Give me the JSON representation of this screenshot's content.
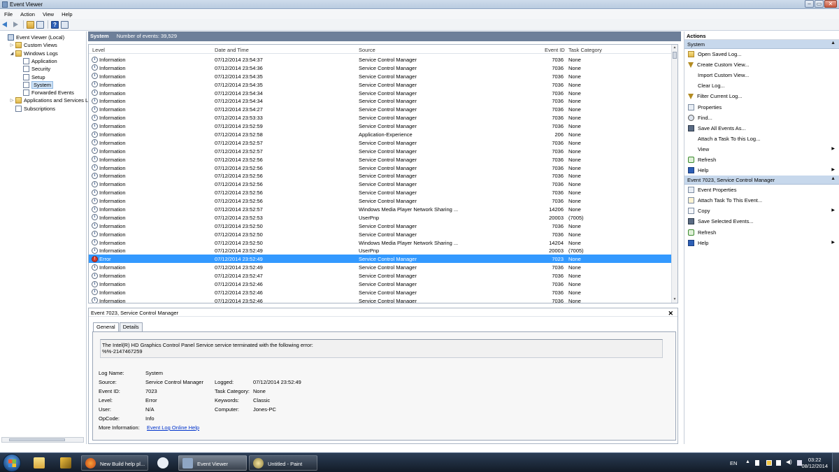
{
  "window": {
    "title": "Event Viewer"
  },
  "menu": [
    "File",
    "Action",
    "View",
    "Help"
  ],
  "tree": [
    {
      "label": "Event Viewer (Local)",
      "level": 0,
      "exp": "",
      "icon": "root"
    },
    {
      "label": "Custom Views",
      "level": 1,
      "exp": "▷",
      "icon": "folder"
    },
    {
      "label": "Windows Logs",
      "level": 1,
      "exp": "◢",
      "icon": "folder"
    },
    {
      "label": "Application",
      "level": 2,
      "exp": "",
      "icon": "log"
    },
    {
      "label": "Security",
      "level": 2,
      "exp": "",
      "icon": "log"
    },
    {
      "label": "Setup",
      "level": 2,
      "exp": "",
      "icon": "log"
    },
    {
      "label": "System",
      "level": 2,
      "exp": "",
      "icon": "log",
      "selected": true
    },
    {
      "label": "Forwarded Events",
      "level": 2,
      "exp": "",
      "icon": "log"
    },
    {
      "label": "Applications and Services Lo",
      "level": 1,
      "exp": "▷",
      "icon": "folder"
    },
    {
      "label": "Subscriptions",
      "level": 1,
      "exp": "",
      "icon": "log"
    }
  ],
  "log": {
    "name": "System",
    "count_text": "Number of events: 39,529"
  },
  "columns": {
    "level": "Level",
    "date": "Date and Time",
    "source": "Source",
    "id": "Event ID",
    "category": "Task Category"
  },
  "events": [
    {
      "level": "Information",
      "date": "07/12/2014 23:54:37",
      "source": "Service Control Manager",
      "id": "7036",
      "category": "None"
    },
    {
      "level": "Information",
      "date": "07/12/2014 23:54:36",
      "source": "Service Control Manager",
      "id": "7036",
      "category": "None"
    },
    {
      "level": "Information",
      "date": "07/12/2014 23:54:35",
      "source": "Service Control Manager",
      "id": "7036",
      "category": "None"
    },
    {
      "level": "Information",
      "date": "07/12/2014 23:54:35",
      "source": "Service Control Manager",
      "id": "7036",
      "category": "None"
    },
    {
      "level": "Information",
      "date": "07/12/2014 23:54:34",
      "source": "Service Control Manager",
      "id": "7036",
      "category": "None"
    },
    {
      "level": "Information",
      "date": "07/12/2014 23:54:34",
      "source": "Service Control Manager",
      "id": "7036",
      "category": "None"
    },
    {
      "level": "Information",
      "date": "07/12/2014 23:54:27",
      "source": "Service Control Manager",
      "id": "7036",
      "category": "None"
    },
    {
      "level": "Information",
      "date": "07/12/2014 23:53:33",
      "source": "Service Control Manager",
      "id": "7036",
      "category": "None"
    },
    {
      "level": "Information",
      "date": "07/12/2014 23:52:59",
      "source": "Service Control Manager",
      "id": "7036",
      "category": "None"
    },
    {
      "level": "Information",
      "date": "07/12/2014 23:52:58",
      "source": "Application-Experience",
      "id": "206",
      "category": "None"
    },
    {
      "level": "Information",
      "date": "07/12/2014 23:52:57",
      "source": "Service Control Manager",
      "id": "7036",
      "category": "None"
    },
    {
      "level": "Information",
      "date": "07/12/2014 23:52:57",
      "source": "Service Control Manager",
      "id": "7036",
      "category": "None"
    },
    {
      "level": "Information",
      "date": "07/12/2014 23:52:56",
      "source": "Service Control Manager",
      "id": "7036",
      "category": "None"
    },
    {
      "level": "Information",
      "date": "07/12/2014 23:52:56",
      "source": "Service Control Manager",
      "id": "7036",
      "category": "None"
    },
    {
      "level": "Information",
      "date": "07/12/2014 23:52:56",
      "source": "Service Control Manager",
      "id": "7036",
      "category": "None"
    },
    {
      "level": "Information",
      "date": "07/12/2014 23:52:56",
      "source": "Service Control Manager",
      "id": "7036",
      "category": "None"
    },
    {
      "level": "Information",
      "date": "07/12/2014 23:52:56",
      "source": "Service Control Manager",
      "id": "7036",
      "category": "None"
    },
    {
      "level": "Information",
      "date": "07/12/2014 23:52:56",
      "source": "Service Control Manager",
      "id": "7036",
      "category": "None"
    },
    {
      "level": "Information",
      "date": "07/12/2014 23:52:57",
      "source": "Windows Media Player Network Sharing ...",
      "id": "14206",
      "category": "None"
    },
    {
      "level": "Information",
      "date": "07/12/2014 23:52:53",
      "source": "UserPnp",
      "id": "20003",
      "category": "(7005)"
    },
    {
      "level": "Information",
      "date": "07/12/2014 23:52:50",
      "source": "Service Control Manager",
      "id": "7036",
      "category": "None"
    },
    {
      "level": "Information",
      "date": "07/12/2014 23:52:50",
      "source": "Service Control Manager",
      "id": "7036",
      "category": "None"
    },
    {
      "level": "Information",
      "date": "07/12/2014 23:52:50",
      "source": "Windows Media Player Network Sharing ...",
      "id": "14204",
      "category": "None"
    },
    {
      "level": "Information",
      "date": "07/12/2014 23:52:49",
      "source": "UserPnp",
      "id": "20003",
      "category": "(7005)"
    },
    {
      "level": "Error",
      "date": "07/12/2014 23:52:49",
      "source": "Service Control Manager",
      "id": "7023",
      "category": "None",
      "selected": true
    },
    {
      "level": "Information",
      "date": "07/12/2014 23:52:49",
      "source": "Service Control Manager",
      "id": "7036",
      "category": "None"
    },
    {
      "level": "Information",
      "date": "07/12/2014 23:52:47",
      "source": "Service Control Manager",
      "id": "7036",
      "category": "None"
    },
    {
      "level": "Information",
      "date": "07/12/2014 23:52:46",
      "source": "Service Control Manager",
      "id": "7036",
      "category": "None"
    },
    {
      "level": "Information",
      "date": "07/12/2014 23:52:46",
      "source": "Service Control Manager",
      "id": "7036",
      "category": "None"
    },
    {
      "level": "Information",
      "date": "07/12/2014 23:52:46",
      "source": "Service Control Manager",
      "id": "7036",
      "category": "None"
    }
  ],
  "detail": {
    "title": "Event 7023, Service Control Manager",
    "close_glyph": "✕",
    "tab_general": "General",
    "tab_details": "Details",
    "description_line1": "The Intel(R) HD Graphics Control Panel Service service terminated with the following error:",
    "description_line2": "%%-2147467259",
    "fields": {
      "log_name_label": "Log Name:",
      "log_name": "System",
      "source_label": "Source:",
      "source": "Service Control Manager",
      "logged_label": "Logged:",
      "logged": "07/12/2014 23:52:49",
      "event_id_label": "Event ID:",
      "event_id": "7023",
      "task_category_label": "Task Category:",
      "task_category": "None",
      "level_label": "Level:",
      "level": "Error",
      "keywords_label": "Keywords:",
      "keywords": "Classic",
      "user_label": "User:",
      "user": "N/A",
      "computer_label": "Computer:",
      "computer": "Jones-PC",
      "opcode_label": "OpCode:",
      "opcode": "Info",
      "more_info_label": "More Information:",
      "more_info_link": "Event Log Online Help"
    }
  },
  "actions": {
    "header": "Actions",
    "section1": "System",
    "section1_items": [
      {
        "label": "Open Saved Log...",
        "icon": "folder",
        "name": "open-saved-log"
      },
      {
        "label": "Create Custom View...",
        "icon": "filter",
        "name": "create-custom-view"
      },
      {
        "label": "Import Custom View...",
        "icon": "blank",
        "name": "import-custom-view"
      },
      {
        "label": "Clear Log...",
        "icon": "blank",
        "name": "clear-log"
      },
      {
        "label": "Filter Current Log...",
        "icon": "filter",
        "name": "filter-current-log"
      },
      {
        "label": "Properties",
        "icon": "props",
        "name": "properties"
      },
      {
        "label": "Find...",
        "icon": "find",
        "name": "find"
      },
      {
        "label": "Save All Events As...",
        "icon": "save",
        "name": "save-all-events"
      },
      {
        "label": "Attach a Task To this Log...",
        "icon": "blank",
        "name": "attach-task-log"
      },
      {
        "label": "View",
        "icon": "blank",
        "name": "view",
        "submenu": true
      },
      {
        "label": "Refresh",
        "icon": "refresh",
        "name": "refresh"
      },
      {
        "label": "Help",
        "icon": "help",
        "name": "help",
        "submenu": true
      }
    ],
    "section2": "Event 7023, Service Control Manager",
    "section2_items": [
      {
        "label": "Event Properties",
        "icon": "props",
        "name": "event-properties"
      },
      {
        "label": "Attach Task To This Event...",
        "icon": "task",
        "name": "attach-task-event"
      },
      {
        "label": "Copy",
        "icon": "copy",
        "name": "copy",
        "submenu": true
      },
      {
        "label": "Save Selected Events...",
        "icon": "save",
        "name": "save-selected-events"
      },
      {
        "label": "Refresh",
        "icon": "refresh",
        "name": "refresh-event"
      },
      {
        "label": "Help",
        "icon": "help",
        "name": "help-event",
        "submenu": true
      }
    ],
    "collapse_glyph": "▲",
    "submenu_glyph": "▶"
  },
  "taskbar": {
    "buttons": [
      {
        "label": "New Build help pl...",
        "color": "#e06a1e"
      },
      {
        "label": "Event Viewer",
        "color": "#8fa6c4",
        "active": true
      },
      {
        "label": "Untitled - Paint",
        "color": "#c8b26a"
      }
    ],
    "lang": "EN",
    "time": "03:22",
    "date": "08/12/2014"
  },
  "colors": {
    "selection": "#3399ff",
    "log_header": "#6d7f99",
    "actions_section": "#c7d8ec",
    "error_icon": "#d63a2a"
  }
}
